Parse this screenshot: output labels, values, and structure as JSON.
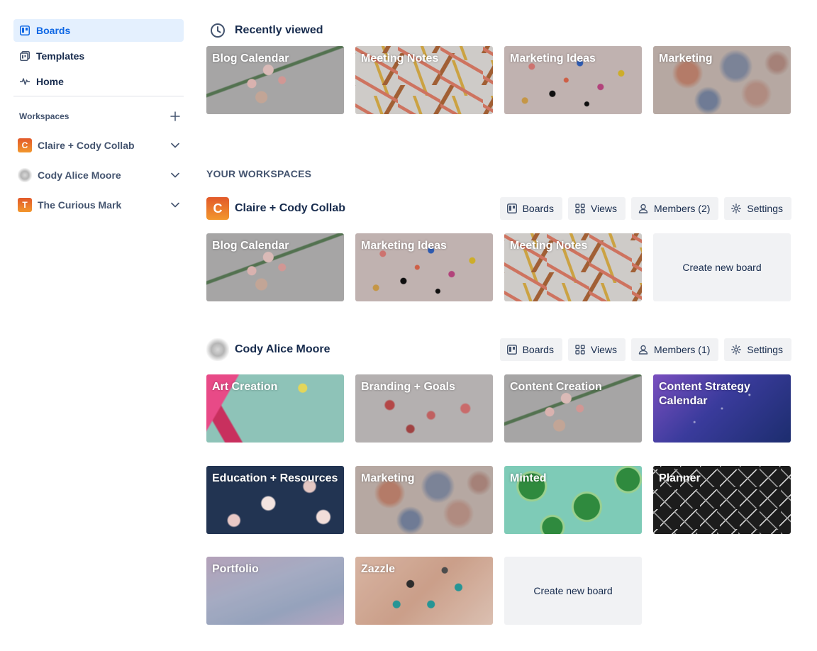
{
  "sidebar": {
    "nav": [
      {
        "label": "Boards",
        "icon": "board-icon",
        "active": true
      },
      {
        "label": "Templates",
        "icon": "template-icon",
        "active": false
      },
      {
        "label": "Home",
        "icon": "activity-icon",
        "active": false
      }
    ],
    "workspaces_label": "Workspaces",
    "workspaces": [
      {
        "label": "Claire + Cody Collab",
        "initial": "C"
      },
      {
        "label": "Cody Alice Moore",
        "initial": ""
      },
      {
        "label": "The Curious Mark",
        "initial": "T"
      }
    ]
  },
  "recent": {
    "title": "Recently viewed",
    "boards": [
      "Blog Calendar",
      "Meeting Notes",
      "Marketing Ideas",
      "Marketing"
    ]
  },
  "your_workspaces_label": "YOUR WORKSPACES",
  "workspace_sections": [
    {
      "name": "Claire + Cody Collab",
      "initial": "C",
      "buttons": {
        "boards": "Boards",
        "views": "Views",
        "members": "Members (2)",
        "settings": "Settings"
      },
      "boards": [
        "Blog Calendar",
        "Marketing Ideas",
        "Meeting Notes"
      ],
      "create_label": "Create new board"
    },
    {
      "name": "Cody Alice Moore",
      "initial": "",
      "buttons": {
        "boards": "Boards",
        "views": "Views",
        "members": "Members (1)",
        "settings": "Settings"
      },
      "boards": [
        "Art Creation",
        "Branding + Goals",
        "Content Creation",
        "Content Strategy Calendar",
        "Education + Resources",
        "Marketing",
        "Minted",
        "Planner",
        "Portfolio",
        "Zazzle"
      ],
      "create_label": "Create new board"
    }
  ],
  "colors": {
    "accent": "#0c66e4",
    "active_bg": "#e4f0fe",
    "tile_button_bg": "#f1f2f4",
    "text": "#172b4d"
  }
}
